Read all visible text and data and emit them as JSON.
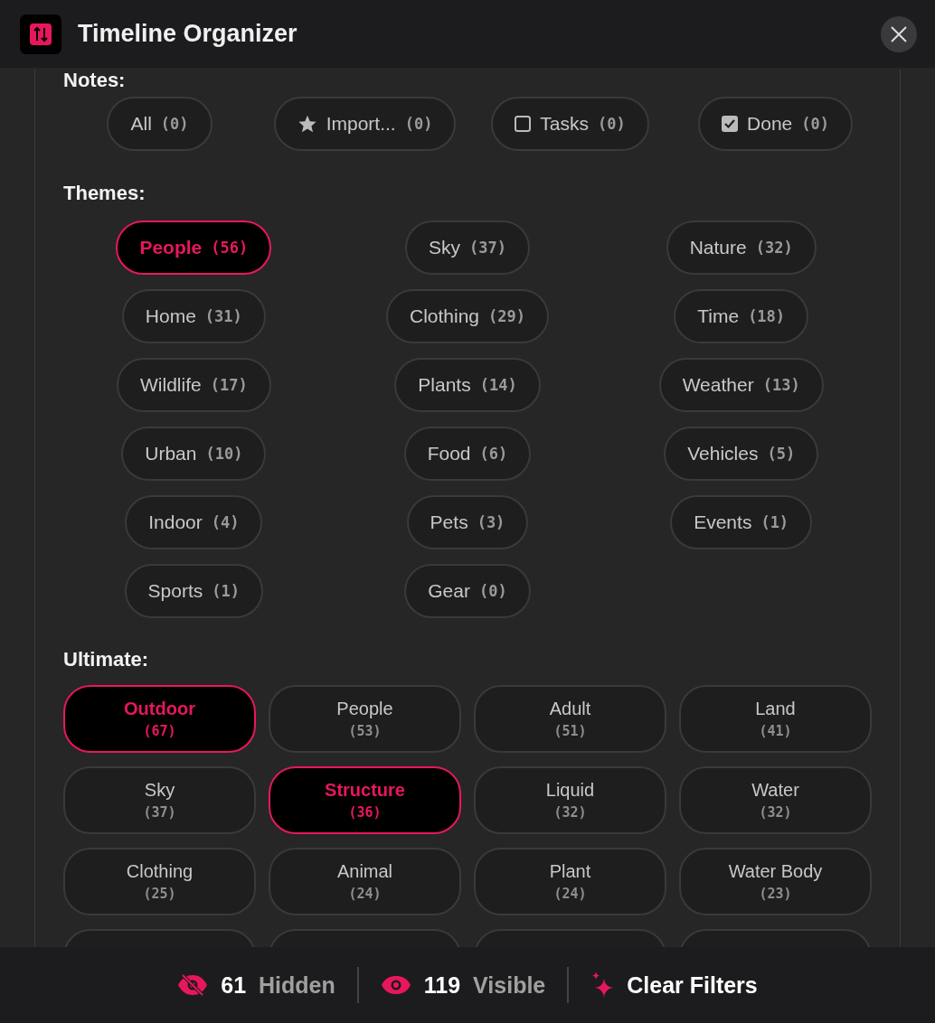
{
  "window": {
    "title": "Timeline Organizer"
  },
  "notes": {
    "heading": "Notes:",
    "chips": [
      {
        "kind": "plain",
        "label": "All",
        "count": "(0)",
        "selected": false
      },
      {
        "kind": "star",
        "label": "Import...",
        "count": "(0)",
        "selected": false
      },
      {
        "kind": "box",
        "label": "Tasks",
        "count": "(0)",
        "selected": false,
        "checked": false
      },
      {
        "kind": "box",
        "label": "Done",
        "count": "(0)",
        "selected": false,
        "checked": true
      }
    ]
  },
  "themes": {
    "heading": "Themes:",
    "chips": [
      {
        "label": "People",
        "count": "(56)",
        "selected": true
      },
      {
        "label": "Sky",
        "count": "(37)",
        "selected": false
      },
      {
        "label": "Nature",
        "count": "(32)",
        "selected": false
      },
      {
        "label": "Home",
        "count": "(31)",
        "selected": false
      },
      {
        "label": "Clothing",
        "count": "(29)",
        "selected": false
      },
      {
        "label": "Time",
        "count": "(18)",
        "selected": false
      },
      {
        "label": "Wildlife",
        "count": "(17)",
        "selected": false
      },
      {
        "label": "Plants",
        "count": "(14)",
        "selected": false
      },
      {
        "label": "Weather",
        "count": "(13)",
        "selected": false
      },
      {
        "label": "Urban",
        "count": "(10)",
        "selected": false
      },
      {
        "label": "Food",
        "count": "(6)",
        "selected": false
      },
      {
        "label": "Vehicles",
        "count": "(5)",
        "selected": false
      },
      {
        "label": "Indoor",
        "count": "(4)",
        "selected": false
      },
      {
        "label": "Pets",
        "count": "(3)",
        "selected": false
      },
      {
        "label": "Events",
        "count": "(1)",
        "selected": false
      },
      {
        "label": "Sports",
        "count": "(1)",
        "selected": false
      },
      {
        "label": "Gear",
        "count": "(0)",
        "selected": false
      }
    ]
  },
  "ultimate": {
    "heading": "Ultimate:",
    "chips": [
      {
        "label": "Outdoor",
        "count": "(67)",
        "selected": true
      },
      {
        "label": "People",
        "count": "(53)",
        "selected": false
      },
      {
        "label": "Adult",
        "count": "(51)",
        "selected": false
      },
      {
        "label": "Land",
        "count": "(41)",
        "selected": false
      },
      {
        "label": "Sky",
        "count": "(37)",
        "selected": false
      },
      {
        "label": "Structure",
        "count": "(36)",
        "selected": true
      },
      {
        "label": "Liquid",
        "count": "(32)",
        "selected": false
      },
      {
        "label": "Water",
        "count": "(32)",
        "selected": false
      },
      {
        "label": "Clothing",
        "count": "(25)",
        "selected": false
      },
      {
        "label": "Animal",
        "count": "(24)",
        "selected": false
      },
      {
        "label": "Plant",
        "count": "(24)",
        "selected": false
      },
      {
        "label": "Water Body",
        "count": "(23)",
        "selected": false
      }
    ]
  },
  "status_bar": [
    {
      "kind": "hidden",
      "count": "61",
      "label": "Hidden"
    },
    {
      "kind": "visible",
      "count": "119",
      "label": "Visible"
    },
    {
      "kind": "clear",
      "label": "Clear Filters"
    }
  ]
}
